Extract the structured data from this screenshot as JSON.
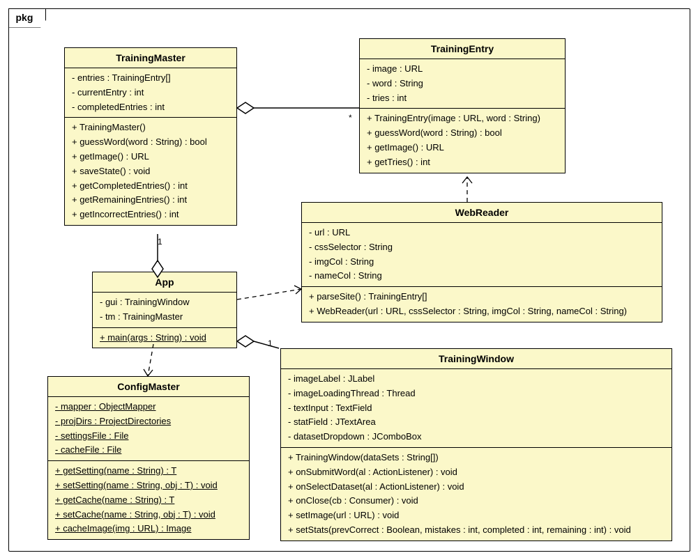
{
  "package": "pkg",
  "classes": {
    "TrainingMaster": {
      "name": "TrainingMaster",
      "attrs": [
        "- entries : TrainingEntry[]",
        "- currentEntry : int",
        "- completedEntries : int"
      ],
      "ops": [
        "+ TrainingMaster()",
        "+ guessWord(word : String) : bool",
        "+ getImage() : URL",
        "+ saveState() : void",
        "+ getCompletedEntries() : int",
        "+ getRemainingEntries() : int",
        "+ getIncorrectEntries() : int"
      ]
    },
    "TrainingEntry": {
      "name": "TrainingEntry",
      "attrs": [
        "- image : URL",
        "- word : String",
        "- tries : int"
      ],
      "ops": [
        "+ TrainingEntry(image : URL, word : String)",
        "+ guessWord(word : String) : bool",
        "+ getImage() : URL",
        "+ getTries() : int"
      ]
    },
    "App": {
      "name": "App",
      "attrs": [
        "- gui : TrainingWindow",
        "- tm : TrainingMaster"
      ],
      "ops_static": [
        "+ main(args : String) : void"
      ]
    },
    "WebReader": {
      "name": "WebReader",
      "attrs": [
        "- url : URL",
        "- cssSelector : String",
        "- imgCol : String",
        "- nameCol : String"
      ],
      "ops": [
        "+ parseSite() : TrainingEntry[]",
        "+ WebReader(url : URL, cssSelector : String, imgCol : String, nameCol : String)"
      ]
    },
    "ConfigMaster": {
      "name": "ConfigMaster",
      "attrs_static": [
        "- mapper : ObjectMapper",
        "- projDirs : ProjectDirectories",
        "- settingsFile : File",
        "- cacheFile : File"
      ],
      "ops_static": [
        "+ getSetting(name : String) : T",
        "+ setSetting(name : String, obj : T) : void",
        "+ getCache(name : String) : T",
        "+ setCache(name : String, obj : T) : void",
        "+ cacheImage(img : URL) : Image"
      ]
    },
    "TrainingWindow": {
      "name": "TrainingWindow",
      "attrs": [
        "- imageLabel : JLabel",
        "- imageLoadingThread : Thread",
        "- textInput : TextField",
        "- statField : JTextArea",
        "- datasetDropdown : JComboBox"
      ],
      "ops": [
        "+ TrainingWindow(dataSets : String[])",
        "+ onSubmitWord(al : ActionListener) : void",
        "+ onSelectDataset(al : ActionListener) : void",
        "+ onClose(cb : Consumer) : void",
        "+ setImage(url : URL) : void",
        "+ setStats(prevCorrect : Boolean, mistakes : int, completed : int, remaining : int) : void"
      ]
    }
  },
  "multiplicities": {
    "tm_to_te": "*",
    "app_to_tm": "1",
    "app_to_tw": "1"
  },
  "chart_data": {
    "type": "diagram",
    "diagram_type": "uml_class_diagram",
    "package": "pkg",
    "classes": [
      "TrainingMaster",
      "TrainingEntry",
      "App",
      "WebReader",
      "ConfigMaster",
      "TrainingWindow"
    ],
    "relationships": [
      {
        "from": "TrainingMaster",
        "to": "TrainingEntry",
        "type": "aggregation",
        "multiplicity_to": "*"
      },
      {
        "from": "App",
        "to": "TrainingMaster",
        "type": "aggregation",
        "multiplicity_to": "1"
      },
      {
        "from": "App",
        "to": "TrainingWindow",
        "type": "aggregation",
        "multiplicity_to": "1"
      },
      {
        "from": "App",
        "to": "WebReader",
        "type": "dependency"
      },
      {
        "from": "App",
        "to": "ConfigMaster",
        "type": "dependency"
      },
      {
        "from": "WebReader",
        "to": "TrainingEntry",
        "type": "dependency"
      }
    ]
  }
}
